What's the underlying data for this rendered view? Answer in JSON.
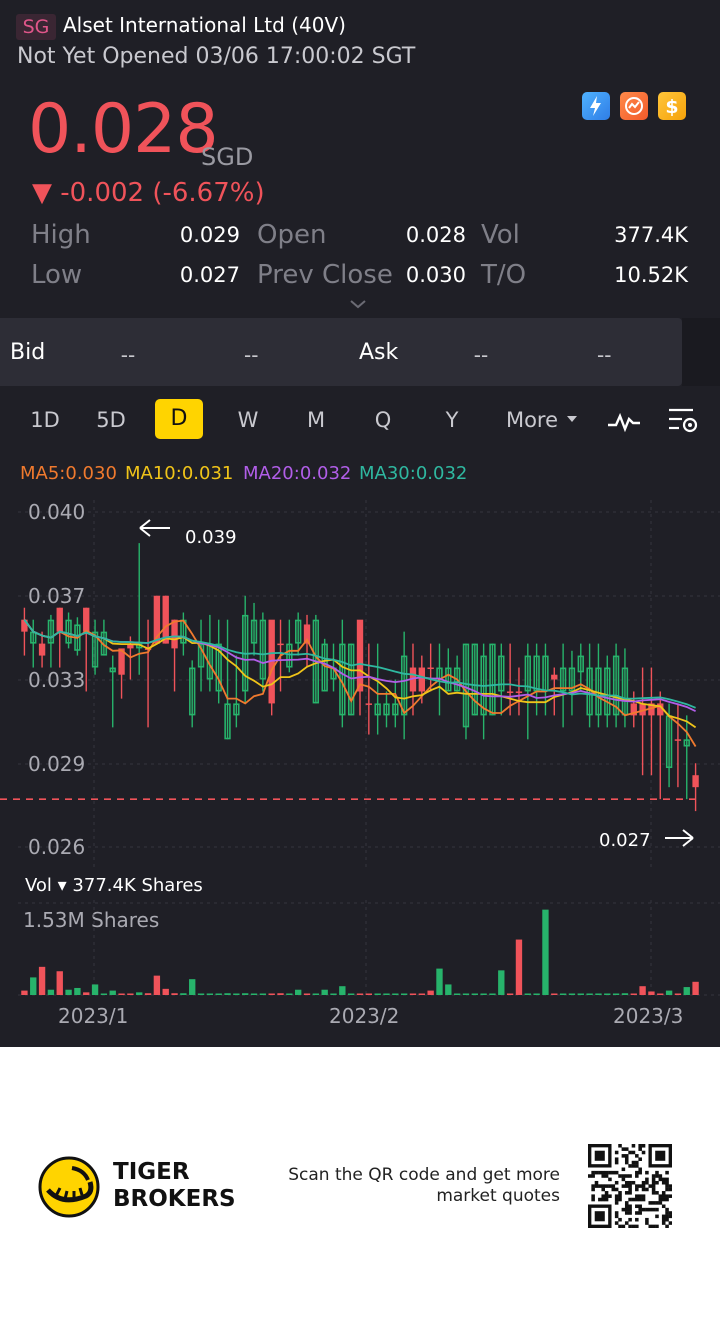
{
  "header": {
    "exchange_badge": "SG",
    "title": "Alset International Ltd (40V)",
    "status": "Not Yet Opened 03/06 17:00:02 SGT",
    "price": "0.028",
    "currency": "SGD",
    "change": "▼ -0.002 (-6.67%)",
    "icons": [
      "lightning-badge-icon",
      "trend-badge-icon",
      "dollar-badge-icon"
    ],
    "price_color": "#f0535a"
  },
  "stats": [
    {
      "label": "High",
      "value": "0.029"
    },
    {
      "label": "Open",
      "value": "0.028"
    },
    {
      "label": "Vol",
      "value": "377.4K"
    },
    {
      "label": "Low",
      "value": "0.027"
    },
    {
      "label": "Prev Close",
      "value": "0.030"
    },
    {
      "label": "T/O",
      "value": "10.52K"
    }
  ],
  "quote": {
    "bid_label": "Bid",
    "bid_price": "--",
    "bid_size": "--",
    "ask_label": "Ask",
    "ask_price": "--",
    "ask_size": "--"
  },
  "tabs": [
    "1D",
    "5D",
    "D",
    "W",
    "M",
    "Q",
    "Y",
    "More"
  ],
  "active_tab": "D",
  "ma_labels": [
    {
      "text": "MA5:0.030",
      "color": "#f07a2e"
    },
    {
      "text": "MA10:0.031",
      "color": "#f0c419"
    },
    {
      "text": "MA20:0.032",
      "color": "#b15ee8"
    },
    {
      "text": "MA30:0.032",
      "color": "#2fb8a0"
    }
  ],
  "volume": {
    "header": "Vol ▾ 377.4K Shares",
    "max_label": "1.53M Shares"
  },
  "footer": {
    "brand_line1": "TIGER",
    "brand_line2": "BROKERS",
    "scan_text": "Scan the QR code and get more market quotes"
  },
  "chart_data": {
    "type": "candlestick",
    "y_ticks": [
      "0.040",
      "0.037",
      "0.033",
      "0.029",
      "0.026"
    ],
    "ylim": [
      0.026,
      0.04
    ],
    "x_ticks": [
      "2023/1",
      "2023/2",
      "2023/3"
    ],
    "high_annotation": "0.039",
    "low_annotation": "0.027",
    "last_price": 0.028,
    "up_color": "#f0535a",
    "down_color": "#27b36b",
    "candles": [
      {
        "o": 0.035,
        "h": 0.036,
        "l": 0.034,
        "c": 0.0355,
        "v": 0.05
      },
      {
        "o": 0.035,
        "h": 0.0355,
        "l": 0.0335,
        "c": 0.0345,
        "v": 0.2
      },
      {
        "o": 0.034,
        "h": 0.035,
        "l": 0.0335,
        "c": 0.0345,
        "v": 0.32
      },
      {
        "o": 0.0355,
        "h": 0.0357,
        "l": 0.0335,
        "c": 0.0345,
        "v": 0.06
      },
      {
        "o": 0.035,
        "h": 0.036,
        "l": 0.0335,
        "c": 0.036,
        "v": 0.27
      },
      {
        "o": 0.0355,
        "h": 0.0358,
        "l": 0.0343,
        "c": 0.0345,
        "v": 0.06
      },
      {
        "o": 0.0353,
        "h": 0.0356,
        "l": 0.034,
        "c": 0.0342,
        "v": 0.08
      },
      {
        "o": 0.035,
        "h": 0.036,
        "l": 0.0325,
        "c": 0.036,
        "v": 0.03
      },
      {
        "o": 0.035,
        "h": 0.0355,
        "l": 0.0332,
        "c": 0.0335,
        "v": 0.12
      },
      {
        "o": 0.035,
        "h": 0.0355,
        "l": 0.034,
        "c": 0.034,
        "v": 0.01
      },
      {
        "o": 0.0335,
        "h": 0.034,
        "l": 0.031,
        "c": 0.0333,
        "v": 0.05
      },
      {
        "o": 0.0332,
        "h": 0.0338,
        "l": 0.0322,
        "c": 0.0343,
        "v": 0.01
      },
      {
        "o": 0.0343,
        "h": 0.0348,
        "l": 0.033,
        "c": 0.0345,
        "v": 0.01
      },
      {
        "o": 0.0345,
        "h": 0.0387,
        "l": 0.0332,
        "c": 0.0343,
        "v": 0.03
      },
      {
        "o": 0.0343,
        "h": 0.0355,
        "l": 0.031,
        "c": 0.0343,
        "v": 0.02
      },
      {
        "o": 0.0345,
        "h": 0.0365,
        "l": 0.0345,
        "c": 0.0365,
        "v": 0.22
      },
      {
        "o": 0.0345,
        "h": 0.0365,
        "l": 0.0345,
        "c": 0.0365,
        "v": 0.07
      },
      {
        "o": 0.0343,
        "h": 0.0355,
        "l": 0.0325,
        "c": 0.0355,
        "v": 0.02
      },
      {
        "o": 0.0355,
        "h": 0.0358,
        "l": 0.034,
        "c": 0.0345,
        "v": 0.02
      },
      {
        "o": 0.0335,
        "h": 0.0338,
        "l": 0.031,
        "c": 0.0315,
        "v": 0.18
      },
      {
        "o": 0.0345,
        "h": 0.0355,
        "l": 0.0325,
        "c": 0.0335,
        "v": 0.01
      },
      {
        "o": 0.0345,
        "h": 0.0357,
        "l": 0.0325,
        "c": 0.033,
        "v": 0.01
      },
      {
        "o": 0.0345,
        "h": 0.0355,
        "l": 0.032,
        "c": 0.0325,
        "v": 0.01
      },
      {
        "o": 0.032,
        "h": 0.0355,
        "l": 0.0305,
        "c": 0.0305,
        "v": 0.02
      },
      {
        "o": 0.032,
        "h": 0.034,
        "l": 0.031,
        "c": 0.0315,
        "v": 0.01
      },
      {
        "o": 0.0357,
        "h": 0.0365,
        "l": 0.032,
        "c": 0.0325,
        "v": 0.02
      },
      {
        "o": 0.0355,
        "h": 0.0362,
        "l": 0.034,
        "c": 0.0345,
        "v": 0.01
      },
      {
        "o": 0.0355,
        "h": 0.0358,
        "l": 0.0325,
        "c": 0.033,
        "v": 0.01
      },
      {
        "o": 0.032,
        "h": 0.0353,
        "l": 0.0315,
        "c": 0.0355,
        "v": 0.01
      },
      {
        "o": 0.0345,
        "h": 0.0355,
        "l": 0.0325,
        "c": 0.0345,
        "v": 0.02
      },
      {
        "o": 0.0345,
        "h": 0.0355,
        "l": 0.0333,
        "c": 0.0335,
        "v": 0.01
      },
      {
        "o": 0.0355,
        "h": 0.0358,
        "l": 0.034,
        "c": 0.0345,
        "v": 0.06
      },
      {
        "o": 0.0345,
        "h": 0.0357,
        "l": 0.0335,
        "c": 0.0353,
        "v": 0.01
      },
      {
        "o": 0.0355,
        "h": 0.0357,
        "l": 0.032,
        "c": 0.032,
        "v": 0.01
      },
      {
        "o": 0.0345,
        "h": 0.0347,
        "l": 0.0325,
        "c": 0.0325,
        "v": 0.06
      },
      {
        "o": 0.0335,
        "h": 0.0345,
        "l": 0.0325,
        "c": 0.033,
        "v": 0.01
      },
      {
        "o": 0.0345,
        "h": 0.0355,
        "l": 0.031,
        "c": 0.0315,
        "v": 0.1
      },
      {
        "o": 0.0345,
        "h": 0.0345,
        "l": 0.0315,
        "c": 0.0315,
        "v": 0.01
      },
      {
        "o": 0.0325,
        "h": 0.0345,
        "l": 0.0315,
        "c": 0.0355,
        "v": 0.01
      },
      {
        "o": 0.032,
        "h": 0.0345,
        "l": 0.0307,
        "c": 0.032,
        "v": 0.01
      },
      {
        "o": 0.032,
        "h": 0.0345,
        "l": 0.0307,
        "c": 0.0315,
        "v": 0.01
      },
      {
        "o": 0.032,
        "h": 0.0325,
        "l": 0.031,
        "c": 0.0315,
        "v": 0.01
      },
      {
        "o": 0.032,
        "h": 0.033,
        "l": 0.031,
        "c": 0.0315,
        "v": 0.01
      },
      {
        "o": 0.034,
        "h": 0.035,
        "l": 0.0305,
        "c": 0.0315,
        "v": 0.01
      },
      {
        "o": 0.0325,
        "h": 0.0345,
        "l": 0.0315,
        "c": 0.0335,
        "v": 0.01
      },
      {
        "o": 0.0325,
        "h": 0.034,
        "l": 0.032,
        "c": 0.0335,
        "v": 0.01
      },
      {
        "o": 0.0335,
        "h": 0.0345,
        "l": 0.0325,
        "c": 0.0335,
        "v": 0.05
      },
      {
        "o": 0.0335,
        "h": 0.0345,
        "l": 0.0315,
        "c": 0.033,
        "v": 0.3
      },
      {
        "o": 0.0335,
        "h": 0.0343,
        "l": 0.0325,
        "c": 0.0325,
        "v": 0.12
      },
      {
        "o": 0.0335,
        "h": 0.034,
        "l": 0.0325,
        "c": 0.0325,
        "v": 0.01
      },
      {
        "o": 0.0345,
        "h": 0.0345,
        "l": 0.0305,
        "c": 0.031,
        "v": 0.01
      },
      {
        "o": 0.0345,
        "h": 0.0345,
        "l": 0.0315,
        "c": 0.0315,
        "v": 0.01
      },
      {
        "o": 0.034,
        "h": 0.0345,
        "l": 0.0305,
        "c": 0.0315,
        "v": 0.01
      },
      {
        "o": 0.0345,
        "h": 0.0345,
        "l": 0.0315,
        "c": 0.0315,
        "v": 0.01
      },
      {
        "o": 0.034,
        "h": 0.0345,
        "l": 0.0315,
        "c": 0.0325,
        "v": 0.28
      },
      {
        "o": 0.0325,
        "h": 0.0345,
        "l": 0.0315,
        "c": 0.0325,
        "v": 0.01
      },
      {
        "o": 0.0325,
        "h": 0.0335,
        "l": 0.0315,
        "c": 0.0325,
        "v": 0.63
      },
      {
        "o": 0.034,
        "h": 0.0345,
        "l": 0.0305,
        "c": 0.0325,
        "v": 0.01
      },
      {
        "o": 0.034,
        "h": 0.0345,
        "l": 0.0315,
        "c": 0.0325,
        "v": 0.01
      },
      {
        "o": 0.034,
        "h": 0.0345,
        "l": 0.0315,
        "c": 0.0325,
        "v": 0.97
      },
      {
        "o": 0.033,
        "h": 0.0335,
        "l": 0.0315,
        "c": 0.0332,
        "v": 0.01
      },
      {
        "o": 0.0335,
        "h": 0.0345,
        "l": 0.031,
        "c": 0.0325,
        "v": 0.01
      },
      {
        "o": 0.0335,
        "h": 0.0342,
        "l": 0.0315,
        "c": 0.0325,
        "v": 0.01
      },
      {
        "o": 0.034,
        "h": 0.0345,
        "l": 0.0325,
        "c": 0.0333,
        "v": 0.01
      },
      {
        "o": 0.0335,
        "h": 0.0345,
        "l": 0.031,
        "c": 0.0315,
        "v": 0.01
      },
      {
        "o": 0.0335,
        "h": 0.0345,
        "l": 0.031,
        "c": 0.0315,
        "v": 0.01
      },
      {
        "o": 0.0335,
        "h": 0.034,
        "l": 0.031,
        "c": 0.0315,
        "v": 0.01
      },
      {
        "o": 0.034,
        "h": 0.0345,
        "l": 0.031,
        "c": 0.0315,
        "v": 0.01
      },
      {
        "o": 0.0335,
        "h": 0.0343,
        "l": 0.031,
        "c": 0.0315,
        "v": 0.02
      },
      {
        "o": 0.0315,
        "h": 0.0325,
        "l": 0.031,
        "c": 0.032,
        "v": 0.01
      },
      {
        "o": 0.0315,
        "h": 0.0335,
        "l": 0.029,
        "c": 0.032,
        "v": 0.1
      },
      {
        "o": 0.0315,
        "h": 0.0335,
        "l": 0.029,
        "c": 0.032,
        "v": 0.04
      },
      {
        "o": 0.0315,
        "h": 0.0325,
        "l": 0.028,
        "c": 0.032,
        "v": 0.01
      },
      {
        "o": 0.0315,
        "h": 0.032,
        "l": 0.0285,
        "c": 0.0293,
        "v": 0.05
      },
      {
        "o": 0.0305,
        "h": 0.032,
        "l": 0.0285,
        "c": 0.0305,
        "v": 0.01
      },
      {
        "o": 0.0305,
        "h": 0.0315,
        "l": 0.028,
        "c": 0.0302,
        "v": 0.09
      },
      {
        "o": 0.0285,
        "h": 0.0295,
        "l": 0.0275,
        "c": 0.029,
        "v": 0.15
      }
    ]
  }
}
